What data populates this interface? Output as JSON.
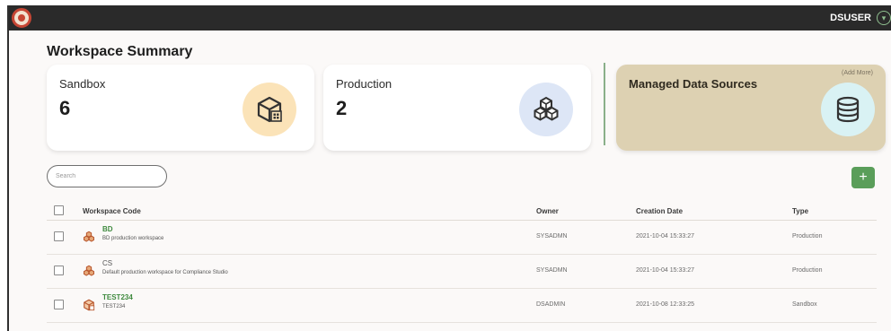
{
  "header": {
    "user": "DSUSER"
  },
  "page": {
    "title": "Workspace Summary"
  },
  "summary": {
    "sandbox": {
      "label": "Sandbox",
      "value": "6"
    },
    "production": {
      "label": "Production",
      "value": "2"
    },
    "managed": {
      "label": "Managed Data Sources",
      "add_more": "(Add More)"
    }
  },
  "search": {
    "placeholder": "Search",
    "value": ""
  },
  "table": {
    "columns": {
      "code": "Workspace Code",
      "owner": "Owner",
      "date": "Creation Date",
      "type": "Type"
    },
    "rows": [
      {
        "code": "BD",
        "desc": "BD production workspace",
        "owner": "SYSADMN",
        "date": "2021-10-04 15:33:27",
        "type": "Production",
        "icon": "production-icon"
      },
      {
        "code": "CS",
        "desc": "Default production workspace for Compliance Studio",
        "owner": "SYSADMN",
        "date": "2021-10-04 15:33:27",
        "type": "Production",
        "icon": "production-icon"
      },
      {
        "code": "TEST234",
        "desc": "TEST234",
        "owner": "DSADMIN",
        "date": "2021-10-08 12:33:25",
        "type": "Sandbox",
        "icon": "sandbox-icon"
      }
    ]
  },
  "colors": {
    "accent_green": "#5a9e5a",
    "link_green": "#3f8a3f",
    "topbar": "#2a2a2a",
    "brand_red": "#c74634",
    "managed_card": "#ddd1b2"
  }
}
